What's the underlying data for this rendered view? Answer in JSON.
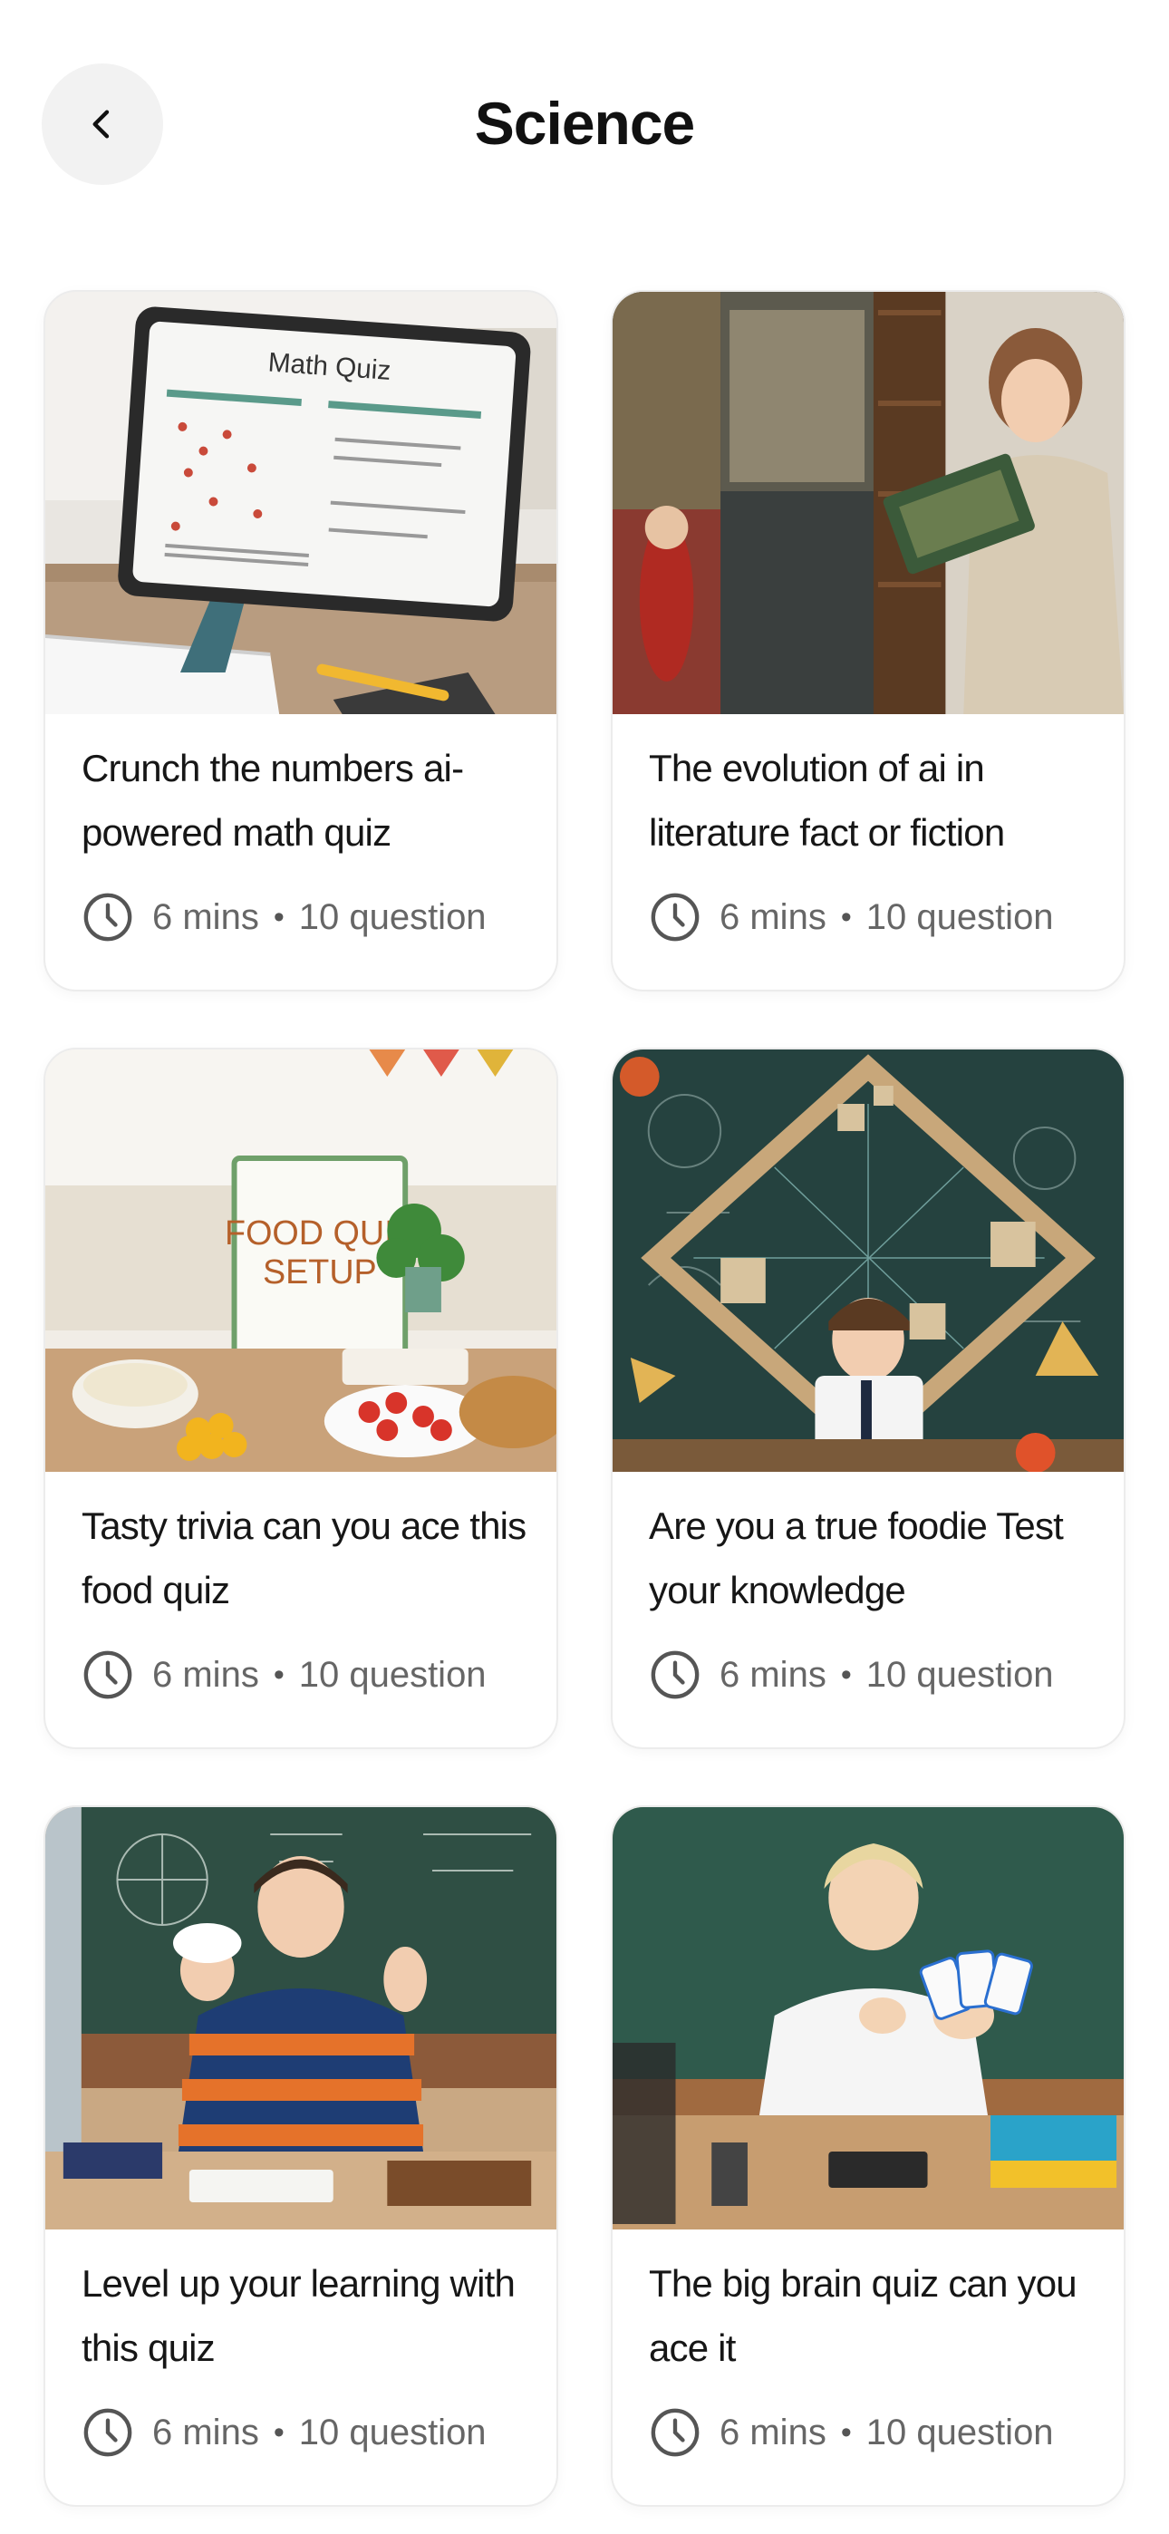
{
  "header": {
    "title": "Science",
    "back_icon": "chevron-left-icon"
  },
  "quizzes": [
    {
      "title": "Crunch the numbers ai-powered math quiz",
      "image": "math-quiz-tablet",
      "image_text": "Math Quiz",
      "duration": "6 mins",
      "questions": "10 question"
    },
    {
      "title": "The evolution of ai in literature fact or fiction",
      "image": "girl-reading-library",
      "duration": "6 mins",
      "questions": "10 question"
    },
    {
      "title": "Tasty trivia can you ace this food quiz",
      "image": "food-quiz-setup",
      "image_text": "FOOD QUIZ SETUP",
      "duration": "6 mins",
      "questions": "10 question"
    },
    {
      "title": "Are you a true foodie Test your knowledge",
      "image": "boy-chalkboard-puzzle",
      "duration": "6 mins",
      "questions": "10 question"
    },
    {
      "title": "Level up your learning with this quiz",
      "image": "student-thumbs-up",
      "duration": "6 mins",
      "questions": "10 question"
    },
    {
      "title": "The big brain quiz can you ace it",
      "image": "teacher-flashcards",
      "duration": "6 mins",
      "questions": "10 question"
    }
  ],
  "meta_separator": "•",
  "clock_icon": "clock-icon"
}
